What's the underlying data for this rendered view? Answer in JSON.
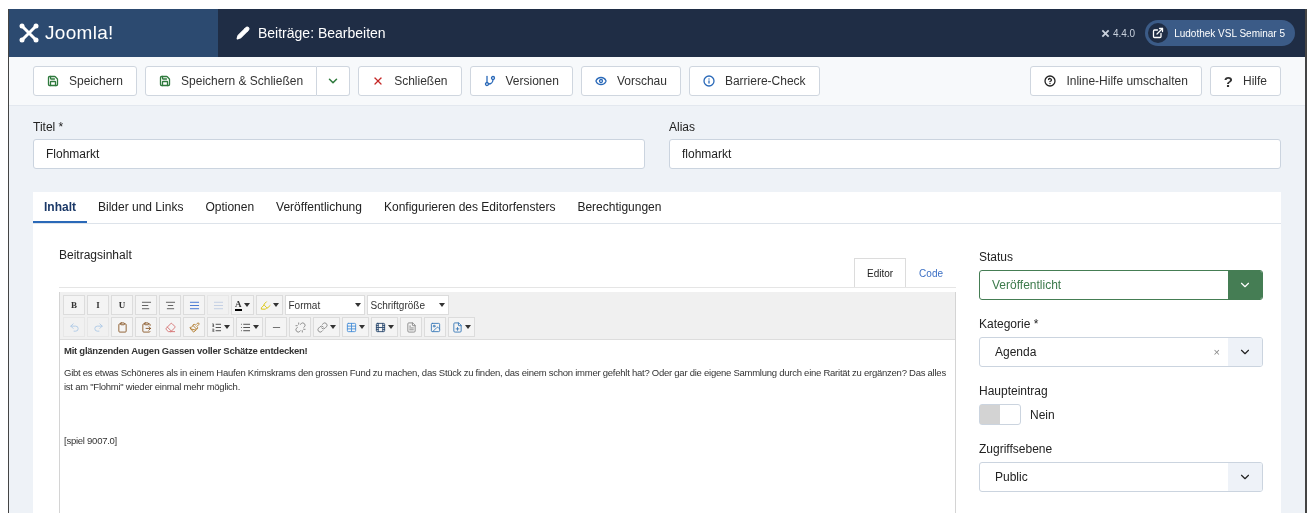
{
  "header": {
    "logo": "Joomla!",
    "title": "Beiträge: Bearbeiten",
    "version": "4.4.0",
    "site_button": "Ludothek VSL Seminar 5"
  },
  "toolbar": {
    "left": [
      {
        "kind": "save",
        "label": "Speichern"
      },
      {
        "kind": "save_split",
        "label": "Speichern & Schließen"
      },
      {
        "kind": "close",
        "label": "Schließen"
      },
      {
        "kind": "versions",
        "label": "Versionen"
      },
      {
        "kind": "preview",
        "label": "Vorschau"
      },
      {
        "kind": "a11y",
        "label": "Barriere-Check"
      }
    ],
    "right": [
      {
        "kind": "help_toggle",
        "label": "Inline-Hilfe umschalten"
      },
      {
        "kind": "help",
        "label": "Hilfe",
        "icon": "?"
      }
    ]
  },
  "title_field": {
    "label": "Titel *",
    "value": "Flohmarkt"
  },
  "alias_field": {
    "label": "Alias",
    "value": "flohmarkt"
  },
  "tabs": [
    {
      "label": "Inhalt",
      "selected": true
    },
    {
      "label": "Bilder und Links",
      "selected": false
    },
    {
      "label": "Optionen",
      "selected": false
    },
    {
      "label": "Veröffentlichung",
      "selected": false
    },
    {
      "label": "Konfigurieren des Editorfensters",
      "selected": false
    },
    {
      "label": "Berechtigungen",
      "selected": false
    }
  ],
  "editor": {
    "label": "Beitragsinhalt",
    "modes": [
      {
        "label": "Editor",
        "selected": true
      },
      {
        "label": "Code",
        "selected": false
      }
    ],
    "toolbar_rows": [
      [
        {
          "kind": "key",
          "label": "B",
          "disabled": false
        },
        {
          "kind": "key",
          "label": "I",
          "disabled": false
        },
        {
          "kind": "key",
          "label": "U",
          "disabled": false
        },
        {
          "kind": "icon",
          "disabled": false
        },
        {
          "kind": "icon",
          "disabled": false
        },
        {
          "kind": "icon",
          "disabled": false
        },
        {
          "kind": "icon",
          "disabled": true
        },
        {
          "kind": "split",
          "label": "A",
          "disabled": false
        },
        {
          "kind": "split",
          "disabled": false
        },
        {
          "kind": "select",
          "label": "Format"
        },
        {
          "kind": "select",
          "label": "Schriftgröße"
        }
      ],
      [
        {
          "kind": "icon",
          "disabled": true
        },
        {
          "kind": "icon",
          "disabled": true
        },
        {
          "kind": "icon",
          "disabled": false
        },
        {
          "kind": "icon",
          "disabled": false
        },
        {
          "kind": "icon",
          "disabled": false
        },
        {
          "kind": "icon",
          "disabled": false
        },
        {
          "kind": "split",
          "disabled": false
        },
        {
          "kind": "split",
          "disabled": false
        },
        {
          "kind": "icon",
          "disabled": false
        },
        {
          "kind": "icon",
          "disabled": false
        },
        {
          "kind": "split",
          "disabled": false
        },
        {
          "kind": "split",
          "disabled": false
        },
        {
          "kind": "split",
          "disabled": false
        },
        {
          "kind": "icon",
          "disabled": false
        },
        {
          "kind": "icon",
          "disabled": false
        },
        {
          "kind": "split",
          "disabled": false
        }
      ]
    ],
    "paragraphs": [
      {
        "kind": "heading",
        "text": "Mit glänzenden Augen Gassen voller Schätze entdecken!"
      },
      {
        "kind": "text",
        "text": "Gibt es etwas Schöneres als in einem Haufen Krimskrams den grossen Fund zu machen, das Stück zu finden, das einem schon immer gefehlt hat? Oder gar die eigene Sammlung durch eine Rarität zu ergänzen? Das alles ist am \"Flohmi\" wieder einmal mehr möglich."
      },
      {
        "kind": "spacer"
      },
      {
        "kind": "text",
        "text": "[spiel 9007.0]"
      }
    ]
  },
  "sidebar": [
    {
      "kind": "status",
      "label": "Status",
      "value": "Veröffentlicht"
    },
    {
      "kind": "clearable",
      "label": "Kategorie *",
      "value": "Agenda",
      "clear": "×"
    },
    {
      "kind": "switch",
      "label": "Haupteintrag",
      "on": false,
      "value": "Nein"
    },
    {
      "kind": "select",
      "label": "Zugriffsebene",
      "value": "Public"
    }
  ]
}
